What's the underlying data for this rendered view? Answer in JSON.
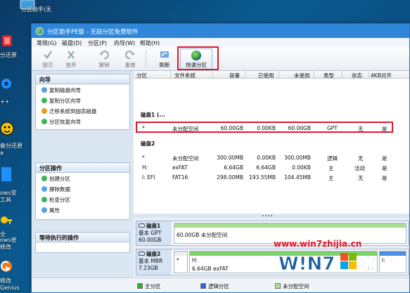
{
  "desktop": {
    "icons": [
      {
        "name": "desktop-icon-partition",
        "label": "分区助手(无"
      },
      {
        "name": "desktop-icon-restore",
        "label": "分还原"
      },
      {
        "name": "desktop-icon-blue",
        "label": "++"
      },
      {
        "name": "desktop-icon-backup",
        "label": "备分还原"
      },
      {
        "name": "desktop-icon-windows-security",
        "label": "ows安"
      },
      {
        "name": "desktop-icon-windows-password",
        "label": "ows密"
      },
      {
        "name": "desktop-icon-genius",
        "label": "Genius"
      }
    ],
    "extra_labels": [
      "a",
      "工具",
      "全",
      "修改",
      "修改"
    ]
  },
  "window": {
    "title": "分区助手PE版 - 无损分区免费软件",
    "menu": [
      "常规(G)",
      "磁盘(D)",
      "分区(P)",
      "向导(W)",
      "帮助(H)"
    ],
    "toolbar": [
      {
        "label": "提交",
        "icon": "check-icon"
      },
      {
        "label": "放弃",
        "icon": "discard-icon"
      },
      {
        "label": "撤销",
        "icon": "undo-icon"
      },
      {
        "label": "重做",
        "icon": "redo-icon"
      },
      {
        "label": "刷新",
        "icon": "refresh-icon"
      }
    ],
    "quick_partition_label": "快速分区"
  },
  "wizard_panel": {
    "title": "向导",
    "items": [
      "复制磁盘向导",
      "复制分区向导",
      "迁移系统到固态磁盘",
      "分区恢复向导"
    ]
  },
  "operations_panel": {
    "title": "分区操作",
    "items": [
      "创建分区",
      "擦除数据",
      "检查分区",
      "属性"
    ]
  },
  "pending_panel": {
    "title": "等待执行的操作"
  },
  "table": {
    "columns": [
      "分区",
      "文件系统",
      "容量",
      "已使用",
      "未使用",
      "类型",
      "状态",
      "4KB对齐"
    ],
    "disk1_header": "磁盘1 (...",
    "disk1_rows": [
      [
        "*",
        "未分配空间",
        "60.00GB",
        "0.00KB",
        "60.00GB",
        "GPT",
        "无",
        "是"
      ]
    ],
    "disk2_header": "磁盘2",
    "disk2_rows": [
      [
        "*",
        "未分配空间",
        "300.00MB",
        "0.00KB",
        "300.00MB",
        "逻辑",
        "无",
        "是"
      ],
      [
        "H:",
        "exFAT",
        "6.64GB",
        "6.64GB",
        "0.00KB",
        "主",
        "活动",
        "是"
      ],
      [
        "I: EFI",
        "FAT16",
        "298.00MB",
        "193.55MB",
        "104.45MB",
        "主",
        "无",
        "是"
      ]
    ]
  },
  "disk_map": {
    "disk1": {
      "name": "磁盘1",
      "style": "基本 GPT",
      "size": "60.00GB",
      "partition_text": "60.00GB 未分配空间"
    },
    "disk2": {
      "name": "磁盘2",
      "style": "基本 MBR",
      "size": "7.23GB",
      "p1_label": "*",
      "p2_label": "H:",
      "p2_detail": "6.64GB exFAT",
      "p3_label": "I:"
    }
  },
  "legend": [
    "主分区",
    "逻辑分区",
    "未分配空间"
  ],
  "watermark": {
    "url": "www.win7zhijia.cn",
    "logo_text": "Win7之家"
  },
  "colors": {
    "primary_partition": "#2fb02f",
    "logical_partition": "#2f5fd0",
    "unallocated": "#a9df8f",
    "highlight_box": "#e0192b",
    "titlebar": "#2f86d8"
  }
}
